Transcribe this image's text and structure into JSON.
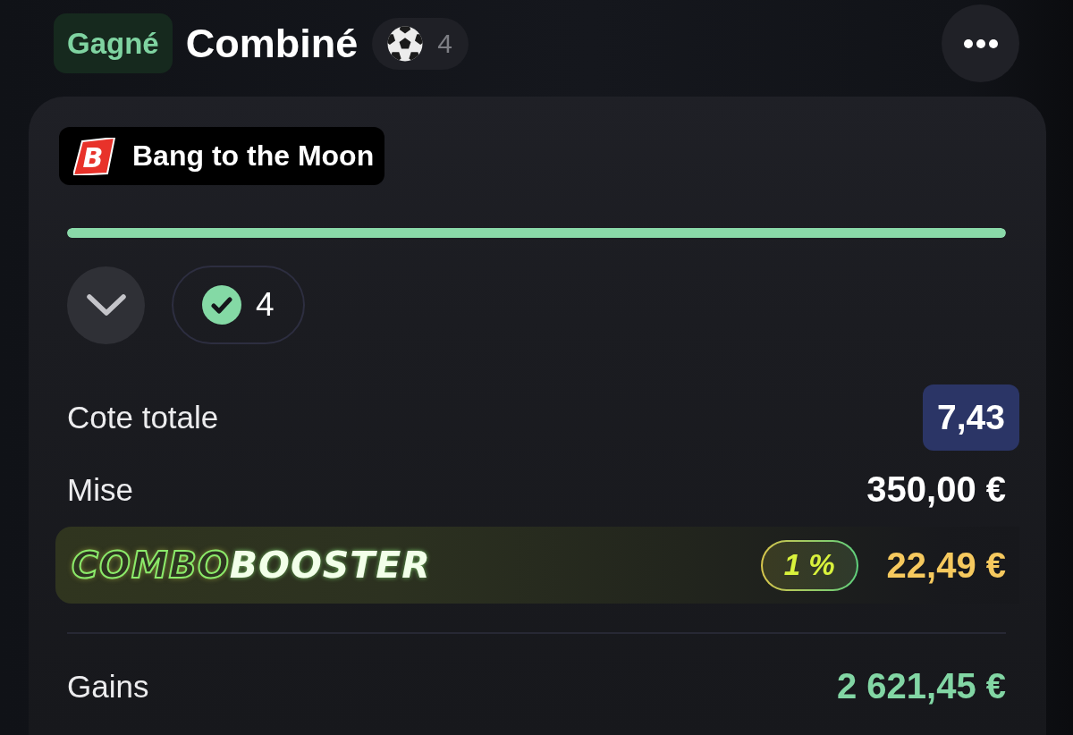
{
  "header": {
    "status": {
      "label": "Gagné",
      "kind": "won"
    },
    "title": "Combiné",
    "sport": {
      "count": "4"
    }
  },
  "promo": {
    "logo_letter": "B",
    "name": "Bang to the Moon"
  },
  "progress": {
    "level": 1
  },
  "legs": {
    "expanded": false,
    "won_count": "4"
  },
  "summary": [
    {
      "kind": "odds",
      "label": "Cote totale",
      "value": "7,43"
    },
    {
      "kind": "amount",
      "label": "Mise",
      "value": "350,00 €"
    }
  ],
  "booster": {
    "logo_parts": [
      "COMBO",
      "BOOSTER"
    ],
    "percent": "1 %",
    "value": "22,49 €"
  },
  "winnings": {
    "label": "Gains",
    "value": "2 621,45 €"
  }
}
